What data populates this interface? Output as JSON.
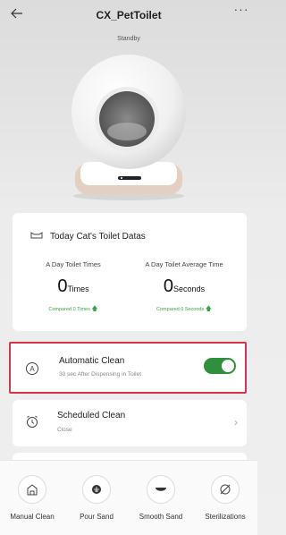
{
  "header": {
    "title": "CX_PetToilet",
    "back_icon": "back-arrow-icon",
    "more_label": "···"
  },
  "device": {
    "status": "Standby"
  },
  "stats": {
    "title": "Today Cat's Toilet Datas",
    "times": {
      "label": "A Day Toilet Times",
      "value": "0",
      "unit": "Times",
      "compare": "Compared 0 Times"
    },
    "average": {
      "label": "A Day Toilet Average Time",
      "value": "0",
      "unit": "Seconds",
      "compare": "Compared 0 Seconds"
    }
  },
  "automatic_clean": {
    "title": "Automatic Clean",
    "subtitle": "30 sec After Dispensing in Toilet",
    "enabled": true
  },
  "scheduled_clean": {
    "title": "Scheduled Clean",
    "subtitle": "Close"
  },
  "actions": [
    {
      "label": "Manual Clean",
      "icon": "manual-clean-icon"
    },
    {
      "label": "Pour Sand",
      "icon": "pour-sand-icon"
    },
    {
      "label": "Smooth Sand",
      "icon": "smooth-sand-icon"
    },
    {
      "label": "Sterilizations",
      "icon": "sterilization-icon"
    }
  ],
  "colors": {
    "toggle_on": "#2f8f3c",
    "highlight_border": "#d8344a",
    "compare_text": "#3aa04a"
  }
}
